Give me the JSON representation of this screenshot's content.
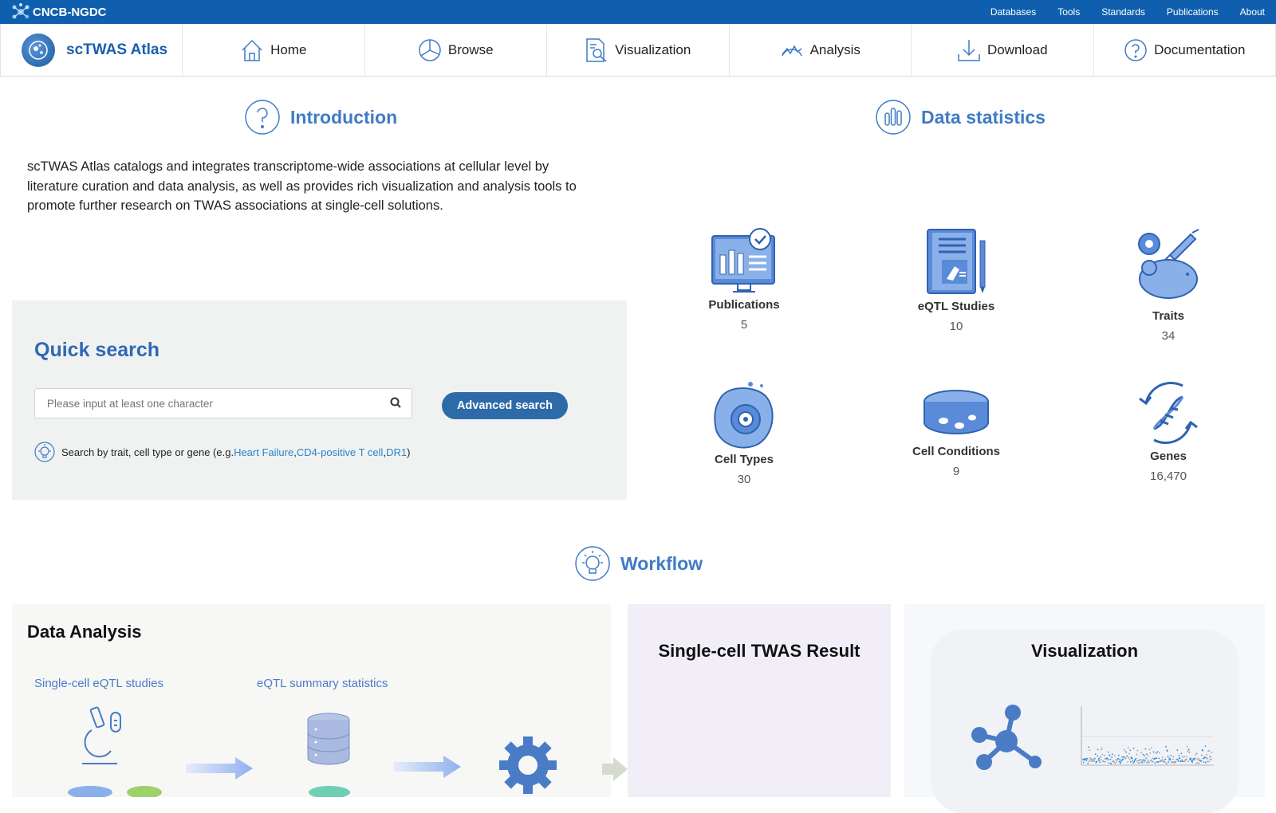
{
  "topbar": {
    "logo": "CNCB-NGDC",
    "links": [
      "Databases",
      "Tools",
      "Standards",
      "Publications",
      "About"
    ]
  },
  "nav": {
    "brand": "scTWAS Atlas",
    "items": [
      "Home",
      "Browse",
      "Visualization",
      "Analysis",
      "Download",
      "Documentation"
    ]
  },
  "introduction": {
    "title": "Introduction",
    "text": "scTWAS Atlas catalogs and integrates transcriptome-wide associations at cellular level by literature curation and data analysis, as well as provides rich visualization and analysis tools to promote further research on TWAS associations at single-cell solutions."
  },
  "quick_search": {
    "title": "Quick search",
    "placeholder": "Please input at least one character",
    "advanced_label": "Advanced search",
    "hint_prefix": "Search by trait, cell type or gene (e.g. ",
    "examples": [
      "Heart Failure",
      "CD4-positive T cell",
      "DR1"
    ],
    "sep1": ", ",
    "sep2": ", ",
    "hint_suffix": ")"
  },
  "data_statistics": {
    "title": "Data statistics",
    "items": [
      {
        "label": "Publications",
        "value": "5",
        "icon": "monitor-chart-icon"
      },
      {
        "label": "eQTL Studies",
        "value": "10",
        "icon": "notebook-microscope-icon"
      },
      {
        "label": "Traits",
        "value": "34",
        "icon": "mouse-syringe-icon"
      },
      {
        "label": "Cell Types",
        "value": "30",
        "icon": "cell-icon"
      },
      {
        "label": "Cell Conditions",
        "value": "9",
        "icon": "petri-dish-icon"
      },
      {
        "label": "Genes",
        "value": "16,470",
        "icon": "dna-icon"
      }
    ]
  },
  "workflow": {
    "title": "Workflow",
    "data_analysis": {
      "title": "Data Analysis",
      "sub1": "Single-cell eQTL studies",
      "sub2": "eQTL summary statistics"
    },
    "result_title": "Single-cell TWAS Result",
    "visualization_title": "Visualization"
  },
  "colors": {
    "topbar": "#0f5fae",
    "accent": "#3f7bc6",
    "button": "#2d6aa8",
    "link": "#2a83c8"
  }
}
